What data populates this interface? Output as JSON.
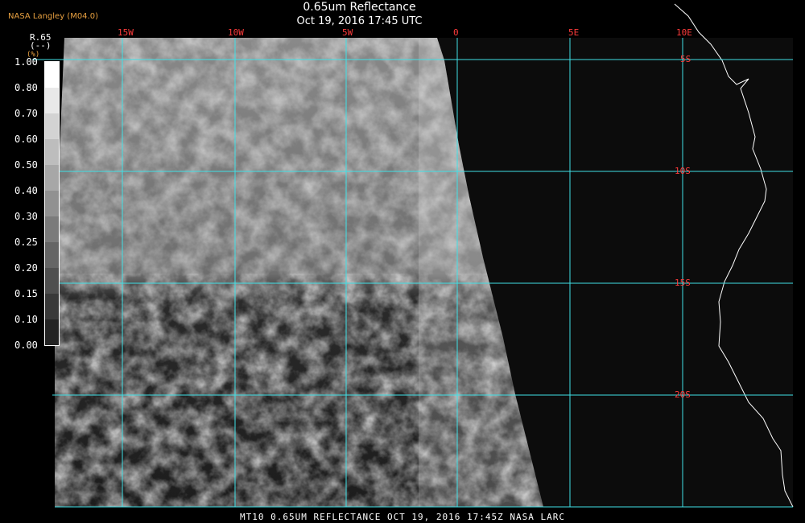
{
  "header": {
    "agency": "NASA Langley (M04.0)",
    "title": "0.65um Reflectance",
    "subtitle": "Oct 19, 2016 17:45 UTC"
  },
  "legend": {
    "label": "R.65\n(--)",
    "unit": "(%)",
    "ticks": [
      "1.00",
      "0.80",
      "0.70",
      "0.60",
      "0.50",
      "0.40",
      "0.30",
      "0.25",
      "0.20",
      "0.15",
      "0.10",
      "0.00"
    ]
  },
  "grid": {
    "lon_labels": [
      "15W",
      "10W",
      "5W",
      "0",
      "5E",
      "10E"
    ],
    "lat_labels": [
      "5S",
      "10S",
      "15S",
      "20S"
    ],
    "color": "#3fe0e6"
  },
  "footer": "MT10  0.65UM REFLECTANCE   OCT 19, 2016 17:45Z   NASA LARC"
}
